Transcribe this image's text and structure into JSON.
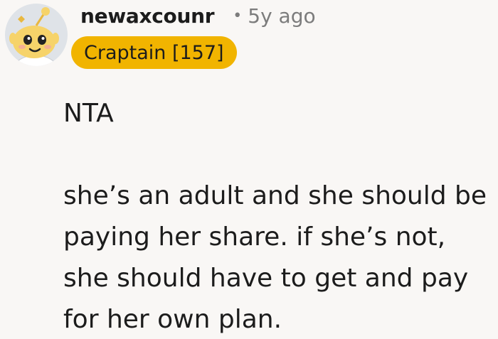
{
  "comment": {
    "avatar_icon": "snoo-avatar-icon",
    "username": "newaxcounr",
    "separator": "•",
    "timestamp": "5y ago",
    "flair": "Craptain [157]",
    "flair_color": "#f1b400",
    "body": {
      "line1": "NTA",
      "line2": "she’s an adult and she should be paying her share. if she’s not, she should have to get and pay for her own plan."
    }
  }
}
